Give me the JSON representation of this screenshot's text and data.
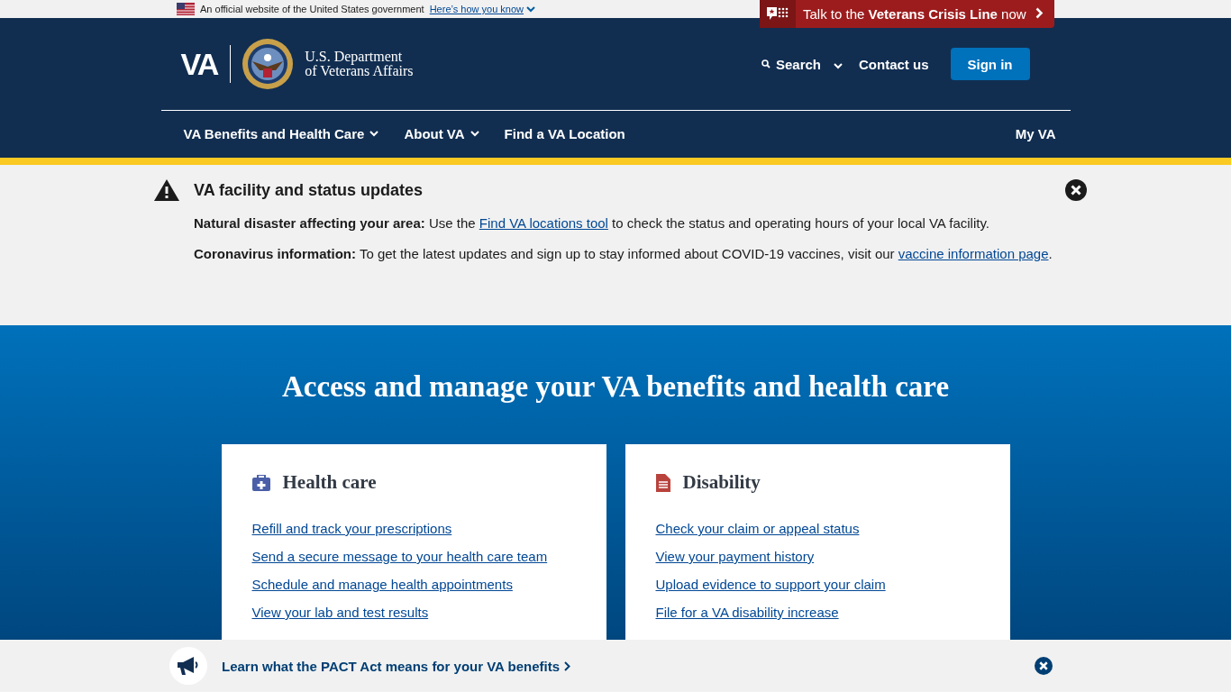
{
  "gov_banner": {
    "text": "An official website of the United States government",
    "link": "Here’s how you know"
  },
  "crisis_line": {
    "text": "Talk to the **Veterans Crisis Line** now"
  },
  "header": {
    "logo": "VA",
    "department": [
      "U.S. Department",
      "of Veterans Affairs"
    ],
    "search": "Search",
    "contact": "Contact us",
    "sign_in": "Sign in"
  },
  "nav": [
    {
      "label": "VA Benefits and Health Care",
      "dropdown": true
    },
    {
      "label": "About VA",
      "dropdown": true
    },
    {
      "label": "Find a VA Location",
      "dropdown": false
    }
  ],
  "my_va": "My VA",
  "alert": {
    "title": "VA facility and status updates",
    "paragraphs": [
      {
        "lead": "Natural disaster affecting your area:",
        "before": " Use the ",
        "link": "Find VA locations tool",
        "after": " to check the status and operating hours of your local VA facility."
      },
      {
        "lead": "Coronavirus information:",
        "before": " To get the latest updates and sign up to stay informed about COVID-19 vaccines, visit our ",
        "link": "vaccine information page",
        "after": "."
      }
    ]
  },
  "hero": {
    "title": "Access and manage your VA benefits and health care",
    "cards": [
      {
        "kind": "medkit",
        "title": "Health care",
        "links": [
          "Refill and track your prescriptions",
          "Send a secure message to your health care team",
          "Schedule and manage health appointments",
          "View your lab and test results"
        ]
      },
      {
        "kind": "document",
        "title": "Disability",
        "links": [
          "Check your claim or appeal status",
          "View your payment history",
          "Upload evidence to support your claim",
          "File for a VA disability increase"
        ]
      }
    ]
  },
  "bottom_banner": {
    "text": "Learn what the PACT Act means for your VA benefits"
  }
}
